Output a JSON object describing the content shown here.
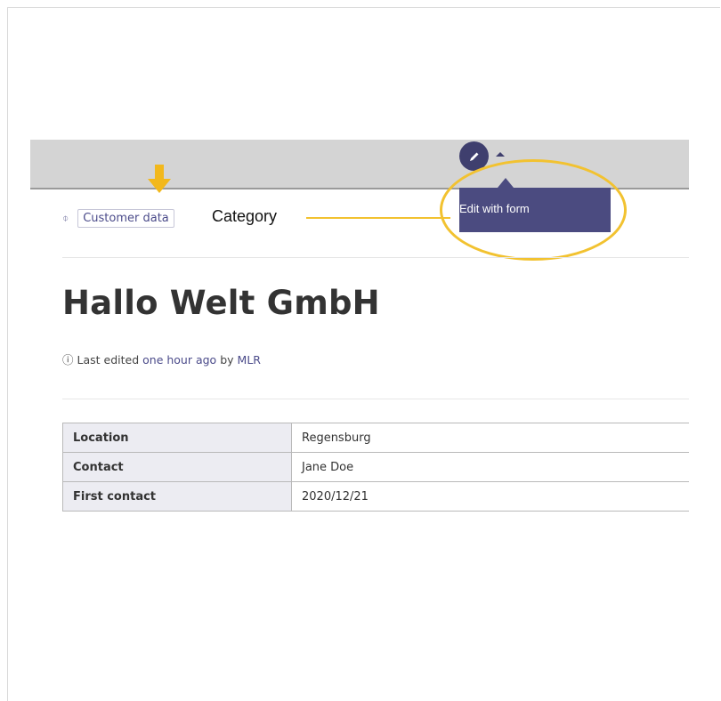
{
  "toolbar": {
    "edit_icon": "pencil-icon",
    "tooltip_label": "Edit with form"
  },
  "category": {
    "icon": "tag-icon",
    "tag_label": "Customer data",
    "callout_label": "Category"
  },
  "page": {
    "title": "Hallo Welt GmbH",
    "meta": {
      "info_icon": "info-icon",
      "prefix": "Last edited",
      "when": "one hour ago",
      "by": "by",
      "author": "MLR"
    }
  },
  "properties": [
    {
      "key": "Location",
      "value": "Regensburg"
    },
    {
      "key": "Contact",
      "value": "Jane Doe"
    },
    {
      "key": "First contact",
      "value": "2020/12/21"
    }
  ],
  "colors": {
    "accent": "#4b4b80",
    "highlight": "#f2c230",
    "arrow": "#f2b81c",
    "link": "#4b4b8a"
  }
}
